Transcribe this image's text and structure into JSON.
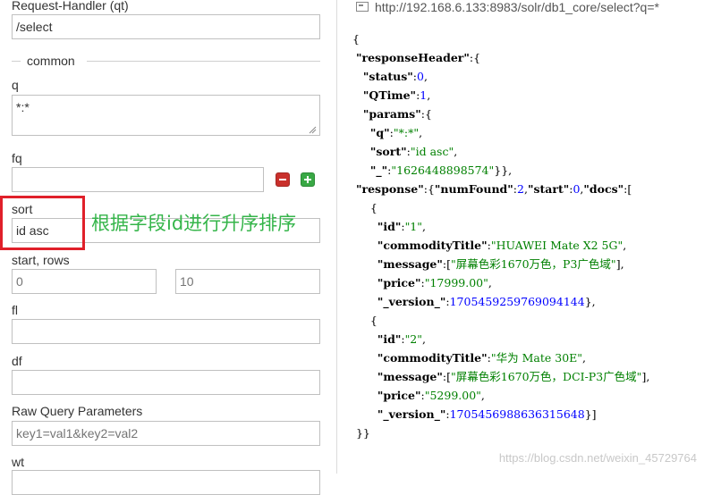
{
  "form": {
    "request_handler_label": "Request-Handler (qt)",
    "request_handler_value": "/select",
    "common_label": "common",
    "q_label": "q",
    "q_value": "*:*",
    "fq_label": "fq",
    "fq_value": "",
    "sort_label": "sort",
    "sort_value": "id asc",
    "start_rows_label": "start, rows",
    "start_placeholder": "0",
    "rows_placeholder": "10",
    "fl_label": "fl",
    "df_label": "df",
    "raw_query_label": "Raw Query Parameters",
    "raw_query_placeholder": "key1=val1&key2=val2",
    "wt_label": "wt"
  },
  "annotation": {
    "text": "根据字段id进行升序排序",
    "color": "#35b54a",
    "box_color": "#e0202a"
  },
  "url": "http://192.168.6.133:8983/solr/db1_core/select?q=*",
  "response_lines": [
    [
      [
        "p",
        "{"
      ]
    ],
    [
      [
        "p",
        " "
      ],
      [
        "k",
        "\"responseHeader\""
      ],
      [
        "p",
        ":{"
      ]
    ],
    [
      [
        "p",
        "   "
      ],
      [
        "k",
        "\"status\""
      ],
      [
        "p",
        ":"
      ],
      [
        "n",
        "0"
      ],
      [
        "p",
        ","
      ]
    ],
    [
      [
        "p",
        "   "
      ],
      [
        "k",
        "\"QTime\""
      ],
      [
        "p",
        ":"
      ],
      [
        "n",
        "1"
      ],
      [
        "p",
        ","
      ]
    ],
    [
      [
        "p",
        "   "
      ],
      [
        "k",
        "\"params\""
      ],
      [
        "p",
        ":{"
      ]
    ],
    [
      [
        "p",
        "     "
      ],
      [
        "k",
        "\"q\""
      ],
      [
        "p",
        ":"
      ],
      [
        "s",
        "\"*:*\""
      ],
      [
        "p",
        ","
      ]
    ],
    [
      [
        "p",
        "     "
      ],
      [
        "k",
        "\"sort\""
      ],
      [
        "p",
        ":"
      ],
      [
        "s",
        "\"id asc\""
      ],
      [
        "p",
        ","
      ]
    ],
    [
      [
        "p",
        "     "
      ],
      [
        "k",
        "\"_\""
      ],
      [
        "p",
        ":"
      ],
      [
        "s",
        "\"1626448898574\""
      ],
      [
        "p",
        "}},"
      ]
    ],
    [
      [
        "p",
        " "
      ],
      [
        "k",
        "\"response\""
      ],
      [
        "p",
        ":{"
      ],
      [
        "k",
        "\"numFound\""
      ],
      [
        "p",
        ":"
      ],
      [
        "n",
        "2"
      ],
      [
        "p",
        ","
      ],
      [
        "k",
        "\"start\""
      ],
      [
        "p",
        ":"
      ],
      [
        "n",
        "0"
      ],
      [
        "p",
        ","
      ],
      [
        "k",
        "\"docs\""
      ],
      [
        "p",
        ":["
      ]
    ],
    [
      [
        "p",
        "     {"
      ]
    ],
    [
      [
        "p",
        "       "
      ],
      [
        "k",
        "\"id\""
      ],
      [
        "p",
        ":"
      ],
      [
        "s",
        "\"1\""
      ],
      [
        "p",
        ","
      ]
    ],
    [
      [
        "p",
        "       "
      ],
      [
        "k",
        "\"commodityTitle\""
      ],
      [
        "p",
        ":"
      ],
      [
        "s",
        "\"HUAWEI Mate X2 5G\""
      ],
      [
        "p",
        ","
      ]
    ],
    [
      [
        "p",
        "       "
      ],
      [
        "k",
        "\"message\""
      ],
      [
        "p",
        ":["
      ],
      [
        "s",
        "\"屏幕色彩1670万色，P3广色域\""
      ],
      [
        "p",
        "],"
      ]
    ],
    [
      [
        "p",
        "       "
      ],
      [
        "k",
        "\"price\""
      ],
      [
        "p",
        ":"
      ],
      [
        "s",
        "\"17999.00\""
      ],
      [
        "p",
        ","
      ]
    ],
    [
      [
        "p",
        "       "
      ],
      [
        "k",
        "\"_version_\""
      ],
      [
        "p",
        ":"
      ],
      [
        "n",
        "1705459259769094144"
      ],
      [
        "p",
        "},"
      ]
    ],
    [
      [
        "p",
        "     {"
      ]
    ],
    [
      [
        "p",
        "       "
      ],
      [
        "k",
        "\"id\""
      ],
      [
        "p",
        ":"
      ],
      [
        "s",
        "\"2\""
      ],
      [
        "p",
        ","
      ]
    ],
    [
      [
        "p",
        "       "
      ],
      [
        "k",
        "\"commodityTitle\""
      ],
      [
        "p",
        ":"
      ],
      [
        "s",
        "\"华为 Mate 30E\""
      ],
      [
        "p",
        ","
      ]
    ],
    [
      [
        "p",
        "       "
      ],
      [
        "k",
        "\"message\""
      ],
      [
        "p",
        ":["
      ],
      [
        "s",
        "\"屏幕色彩1670万色，DCI-P3广色域\""
      ],
      [
        "p",
        "],"
      ]
    ],
    [
      [
        "p",
        "       "
      ],
      [
        "k",
        "\"price\""
      ],
      [
        "p",
        ":"
      ],
      [
        "s",
        "\"5299.00\""
      ],
      [
        "p",
        ","
      ]
    ],
    [
      [
        "p",
        "       "
      ],
      [
        "k",
        "\"_version_\""
      ],
      [
        "p",
        ":"
      ],
      [
        "n",
        "1705456988636315648"
      ],
      [
        "p",
        "}]"
      ]
    ],
    [
      [
        "p",
        " }}"
      ]
    ]
  ],
  "watermark": "https://blog.csdn.net/weixin_45729764"
}
